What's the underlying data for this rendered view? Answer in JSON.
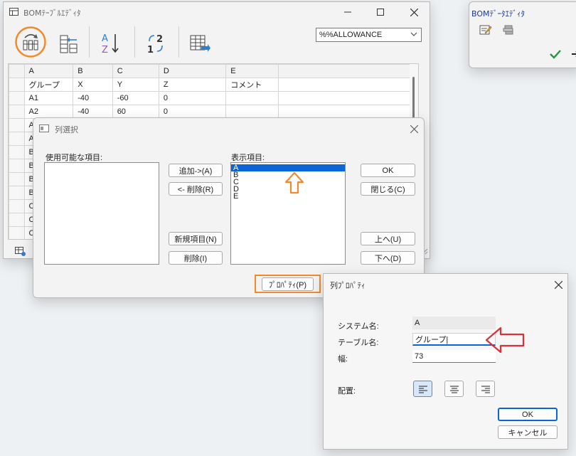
{
  "bom_table_editor": {
    "title": "BOMﾃｰﾌﾞﾙｴﾃﾞｨﾀ",
    "icons": [
      "sort-by-column-icon",
      "column-settings-icon",
      "sort-a-z-icon",
      "sort-1-2-icon",
      "export-table-icon"
    ],
    "selector_value": "%%ALLOWANCE",
    "grid": {
      "columns": [
        "A",
        "B",
        "C",
        "D",
        "E"
      ],
      "rows": [
        [
          "グループ",
          "X",
          "Y",
          "Z",
          "コメント"
        ],
        [
          "A1",
          "-40",
          "-60",
          "0",
          ""
        ],
        [
          "A2",
          "-40",
          "60",
          "0",
          ""
        ],
        [
          "A",
          "",
          "",
          "",
          ""
        ],
        [
          "A",
          "",
          "",
          "",
          ""
        ],
        [
          "B",
          "",
          "",
          "",
          ""
        ],
        [
          "B",
          "",
          "",
          "",
          ""
        ],
        [
          "B",
          "",
          "",
          "",
          ""
        ],
        [
          "B",
          "",
          "",
          "",
          ""
        ],
        [
          "C",
          "",
          "",
          "",
          ""
        ],
        [
          "C",
          "",
          "",
          "",
          ""
        ],
        [
          "C",
          "",
          "",
          "",
          ""
        ]
      ]
    },
    "highlight_color": "#f28a2c"
  },
  "bom_data_editor": {
    "title": "BOMﾃﾞｰﾀｴﾃﾞｨﾀ"
  },
  "column_select": {
    "title": "列選択",
    "available_label": "使用可能な項目:",
    "display_label": "表示項目:",
    "add_button": "追加->(A)",
    "remove_button": "<- 削除(R)",
    "new_item_button": "新規項目(N)",
    "delete_button": "削除(I)",
    "ok_button": "OK",
    "close_button": "閉じる(C)",
    "up_button": "上へ(U)",
    "down_button": "下へ(D)",
    "properties_button": "ﾌﾟﾛﾊﾟﾃｨ(P)",
    "display_items": [
      "A",
      "B",
      "C",
      "D",
      "E"
    ],
    "selected_item": "A"
  },
  "column_properties": {
    "title": "列ﾌﾟﾛﾊﾟﾃｨ",
    "system_name_label": "システム名:",
    "system_name_value": "A",
    "table_name_label": "テーブル名:",
    "table_name_value": "グループ|",
    "width_label": "幅:",
    "width_value": "73",
    "alignment_label": "配置:",
    "ok_button": "OK",
    "cancel_button": "キャンセル",
    "alignment_selected": "left"
  },
  "colors": {
    "accent_blue": "#0a66d8",
    "highlight_orange": "#f28a2c",
    "arrow_red": "#d9303a"
  }
}
